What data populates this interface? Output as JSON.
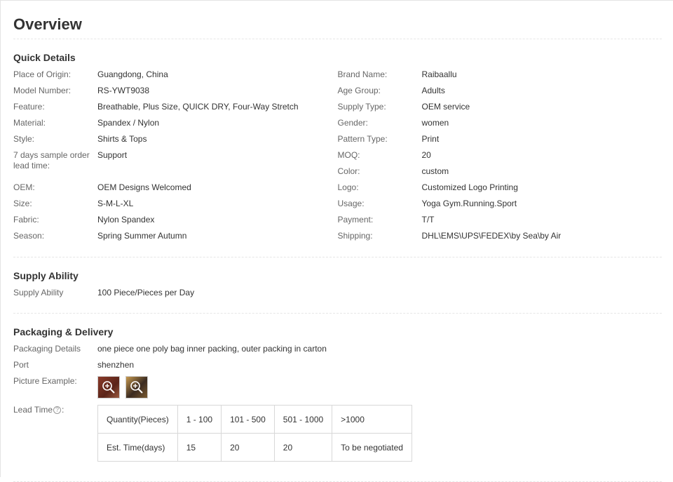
{
  "title": "Overview",
  "quick_details": {
    "heading": "Quick Details",
    "left": [
      {
        "key": "Place of Origin:",
        "value": "Guangdong, China"
      },
      {
        "key": "Model Number:",
        "value": "RS-YWT9038"
      },
      {
        "key": "Feature:",
        "value": "Breathable, Plus Size, QUICK DRY, Four-Way Stretch"
      },
      {
        "key": "Material:",
        "value": "Spandex / Nylon"
      },
      {
        "key": "Style:",
        "value": "Shirts & Tops"
      },
      {
        "key": "7 days sample order lead time:",
        "value": "Support"
      },
      {
        "key": "OEM:",
        "value": "OEM Designs Welcomed"
      },
      {
        "key": "Size:",
        "value": "S-M-L-XL"
      },
      {
        "key": "Fabric:",
        "value": "Nylon Spandex"
      },
      {
        "key": "Season:",
        "value": "Spring Summer Autumn"
      }
    ],
    "right": [
      {
        "key": "Brand Name:",
        "value": "Raibaallu"
      },
      {
        "key": "Age Group:",
        "value": "Adults"
      },
      {
        "key": "Supply Type:",
        "value": "OEM service"
      },
      {
        "key": "Gender:",
        "value": "women"
      },
      {
        "key": "Pattern Type:",
        "value": "Print"
      },
      {
        "key": "MOQ:",
        "value": "20"
      },
      {
        "key": "Color:",
        "value": "custom"
      },
      {
        "key": "Logo:",
        "value": "Customized Logo Printing"
      },
      {
        "key": "Usage:",
        "value": "Yoga Gym.Running.Sport"
      },
      {
        "key": "Payment:",
        "value": "T/T"
      },
      {
        "key": "Shipping:",
        "value": "DHL\\EMS\\UPS\\FEDEX\\by Sea\\by Air"
      }
    ]
  },
  "supply_ability": {
    "heading": "Supply Ability",
    "key": "Supply Ability",
    "value": "100 Piece/Pieces per Day"
  },
  "packaging": {
    "heading": "Packaging & Delivery",
    "details_key": "Packaging Details",
    "details_value": "one piece one poly bag inner packing, outer packing in carton",
    "port_key": "Port",
    "port_value": "shenzhen",
    "picture_key": "Picture Example:",
    "pictures": [
      "zoom-icon",
      "zoom-icon"
    ],
    "lead_time_label": "Lead Time",
    "lead_time_suffix": ":",
    "lead_table": {
      "header": [
        "Quantity(Pieces)",
        "1 - 100",
        "101 - 500",
        "501 - 1000",
        ">1000"
      ],
      "row": [
        "Est. Time(days)",
        "15",
        "20",
        "20",
        "To be negotiated"
      ]
    }
  }
}
